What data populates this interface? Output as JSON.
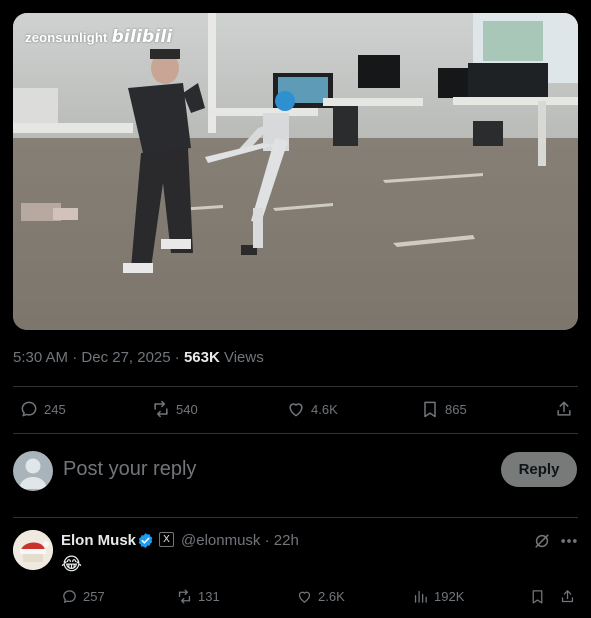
{
  "video": {
    "watermark_text": "zeonsunlight",
    "watermark_logo": "bilibili"
  },
  "meta": {
    "time": "5:30 AM",
    "sep1": " · ",
    "date": "Dec 27, 2025",
    "sep2": " · ",
    "views_count": "563K",
    "views_label": " Views"
  },
  "actions": {
    "replies": "245",
    "reposts": "540",
    "likes": "4.6K",
    "bookmarks": "865"
  },
  "composer": {
    "placeholder": "Post your reply",
    "reply_button": "Reply"
  },
  "reply": {
    "name": "Elon Musk",
    "badge": "X",
    "handle": "@elonmusk",
    "sep": " · ",
    "time": "22h",
    "emoji": "😂",
    "replies": "257",
    "reposts": "131",
    "likes": "2.6K",
    "views": "192K"
  },
  "colors": {
    "background": "#000000",
    "text": "#e7e9ea",
    "muted": "#71767b",
    "verified": "#1d9bf0",
    "reply_button": "#787a7a"
  },
  "icons": [
    "reply-icon",
    "repost-icon",
    "like-icon",
    "bookmark-icon",
    "share-icon",
    "verified-icon",
    "grok-icon",
    "more-icon",
    "views-icon"
  ]
}
